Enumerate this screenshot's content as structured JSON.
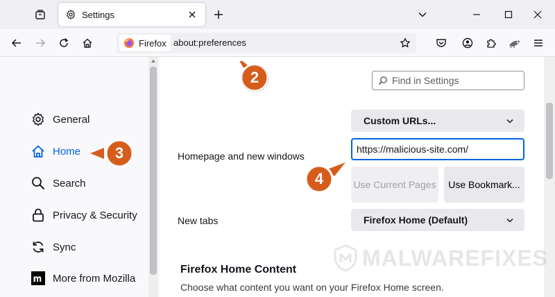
{
  "browser": {
    "tab": {
      "title": "Settings"
    },
    "urlbar": {
      "identity_label": "Firefox",
      "url": "about:preferences"
    }
  },
  "sidebar": {
    "items": [
      {
        "label": "General",
        "icon": "gear-icon"
      },
      {
        "label": "Home",
        "icon": "home-icon",
        "active": true
      },
      {
        "label": "Search",
        "icon": "search-icon"
      },
      {
        "label": "Privacy & Security",
        "icon": "lock-icon"
      },
      {
        "label": "Sync",
        "icon": "sync-icon"
      },
      {
        "label": "More from Mozilla",
        "icon": "mozilla-icon"
      }
    ]
  },
  "main": {
    "search": {
      "placeholder": "Find in Settings"
    },
    "homepage": {
      "label": "Homepage and new windows",
      "select_value": "Custom URLs...",
      "url_value": "https://malicious-site.com/",
      "use_current_label": "Use Current Pages",
      "use_bookmark_label": "Use Bookmark..."
    },
    "newtabs": {
      "label": "New tabs",
      "select_value": "Firefox Home (Default)"
    },
    "home_content": {
      "title": "Firefox Home Content",
      "description": "Choose what content you want on your Firefox Home screen."
    }
  },
  "annotations": {
    "steps": [
      "2",
      "3",
      "4"
    ],
    "badge_color": "#d65c1c"
  },
  "watermark": {
    "text": "MALWAREFIXES"
  },
  "colors": {
    "accent": "#0061e0",
    "badge": "#d65c1c"
  }
}
